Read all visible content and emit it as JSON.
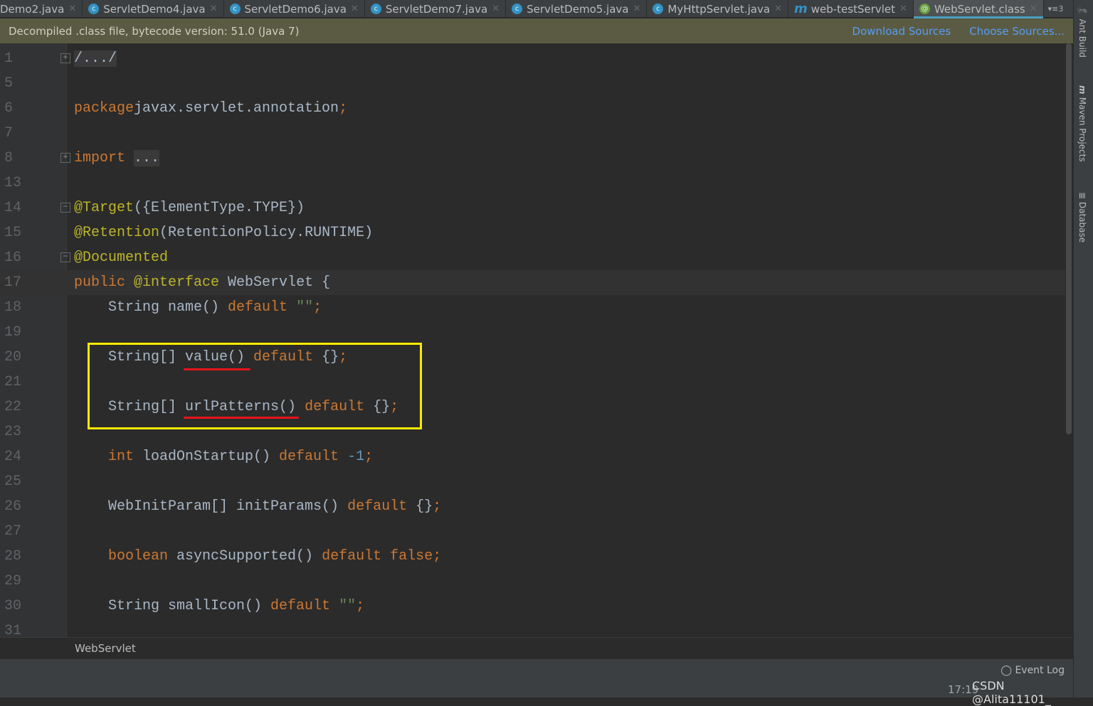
{
  "tabs": [
    {
      "label": "Demo2.java",
      "icon": "class-icon"
    },
    {
      "label": "ServletDemo4.java",
      "icon": "class-icon"
    },
    {
      "label": "ServletDemo6.java",
      "icon": "class-icon"
    },
    {
      "label": "ServletDemo7.java",
      "icon": "class-icon"
    },
    {
      "label": "ServletDemo5.java",
      "icon": "class-icon"
    },
    {
      "label": "MyHttpServlet.java",
      "icon": "class-icon"
    },
    {
      "label": "web-testServlet",
      "icon": "maven-icon"
    },
    {
      "label": "WebServlet.class",
      "icon": "annotation-icon",
      "active": true
    }
  ],
  "tabs_more": "▾≡3",
  "banner": {
    "text": "Decompiled .class file, bytecode version: 51.0 (Java 7)",
    "download": "Download Sources",
    "choose": "Choose Sources..."
  },
  "right_panels": [
    "Ant Build",
    "Maven Projects",
    "Database"
  ],
  "code": [
    {
      "n": "1",
      "fold": "+",
      "toks": [
        [
          "f",
          "/.../"
        ]
      ]
    },
    {
      "n": "5",
      "toks": []
    },
    {
      "n": "6",
      "toks": [
        [
          "k",
          "package"
        ],
        [
          "",
          "javax.servlet.annotation"
        ],
        [
          "k",
          ";"
        ]
      ]
    },
    {
      "n": "7",
      "toks": []
    },
    {
      "n": "8",
      "fold": "+",
      "toks": [
        [
          "k",
          "import "
        ],
        [
          "f",
          "..."
        ]
      ]
    },
    {
      "n": "13",
      "toks": []
    },
    {
      "n": "14",
      "fold": "-",
      "toks": [
        [
          "a",
          "@Target"
        ],
        [
          "",
          "({ElementType.TYPE})"
        ]
      ]
    },
    {
      "n": "15",
      "toks": [
        [
          "a",
          "@Retention"
        ],
        [
          "",
          "(RetentionPolicy.RUNTIME)"
        ]
      ]
    },
    {
      "n": "16",
      "fold": "-",
      "toks": [
        [
          "a",
          "@Documented"
        ]
      ]
    },
    {
      "n": "17",
      "cur": true,
      "toks": [
        [
          "k",
          "public "
        ],
        [
          "a",
          "@interface "
        ],
        [
          "",
          "WebServlet {"
        ]
      ]
    },
    {
      "n": "18",
      "toks": [
        [
          "",
          "    String name() "
        ],
        [
          "k",
          "default "
        ],
        [
          "s",
          "\"\""
        ],
        [
          "k",
          ";"
        ]
      ]
    },
    {
      "n": "19",
      "toks": []
    },
    {
      "n": "20",
      "toks": [
        [
          "",
          "    String[] value() "
        ],
        [
          "k",
          "default "
        ],
        [
          "",
          "{}"
        ],
        [
          "k",
          ";"
        ]
      ]
    },
    {
      "n": "21",
      "toks": []
    },
    {
      "n": "22",
      "toks": [
        [
          "",
          "    String[] urlPatterns() "
        ],
        [
          "k",
          "default "
        ],
        [
          "",
          "{}"
        ],
        [
          "k",
          ";"
        ]
      ]
    },
    {
      "n": "23",
      "toks": []
    },
    {
      "n": "24",
      "toks": [
        [
          "k",
          "    int "
        ],
        [
          "",
          "loadOnStartup() "
        ],
        [
          "k",
          "default "
        ],
        [
          "n",
          "-1"
        ],
        [
          "k",
          ";"
        ]
      ]
    },
    {
      "n": "25",
      "toks": []
    },
    {
      "n": "26",
      "toks": [
        [
          "",
          "    WebInitParam[] initParams() "
        ],
        [
          "k",
          "default "
        ],
        [
          "",
          "{}"
        ],
        [
          "k",
          ";"
        ]
      ]
    },
    {
      "n": "27",
      "toks": []
    },
    {
      "n": "28",
      "toks": [
        [
          "k",
          "    boolean "
        ],
        [
          "",
          "asyncSupported() "
        ],
        [
          "k",
          "default false;"
        ]
      ]
    },
    {
      "n": "29",
      "toks": []
    },
    {
      "n": "30",
      "toks": [
        [
          "",
          "    String smallIcon() "
        ],
        [
          "k",
          "default "
        ],
        [
          "s",
          "\"\""
        ],
        [
          "k",
          ";"
        ]
      ]
    },
    {
      "n": "31",
      "toks": []
    }
  ],
  "breadcrumb": "WebServlet",
  "status": {
    "event_log": "Event Log",
    "time": "17:19",
    "watermark": "CSDN @Alita11101_"
  },
  "colors": {
    "highlight_box": "#ffea00",
    "underline": "#e8141a",
    "keyword": "#cc7832",
    "annotation": "#bbb529"
  }
}
